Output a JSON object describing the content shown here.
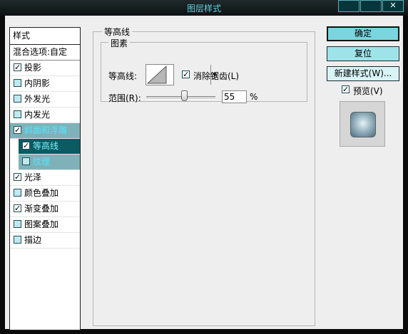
{
  "window": {
    "title": "图层样式",
    "btn_min": "",
    "btn_max": "",
    "btn_close": "✕"
  },
  "sidebar": {
    "header": "样式",
    "items": [
      {
        "label": "混合选项:自定",
        "checked": null
      },
      {
        "label": "投影",
        "checked": true
      },
      {
        "label": "内阴影",
        "checked": false
      },
      {
        "label": "外发光",
        "checked": false
      },
      {
        "label": "内发光",
        "checked": false
      },
      {
        "label": "斜面和浮雕",
        "checked": true,
        "selected": true
      },
      {
        "label": "等高线",
        "checked": true,
        "sub": true,
        "active": true
      },
      {
        "label": "纹理",
        "checked": false,
        "sub": true
      },
      {
        "label": "光泽",
        "checked": true
      },
      {
        "label": "颜色叠加",
        "checked": false
      },
      {
        "label": "渐变叠加",
        "checked": true
      },
      {
        "label": "图案叠加",
        "checked": false
      },
      {
        "label": "描边",
        "checked": false
      }
    ]
  },
  "main": {
    "group_title": "等高线",
    "subgroup_title": "图素",
    "contour_label": "等高线:",
    "antialias_label": "消除锯齿(L)",
    "antialias_checked": true,
    "range_label": "范围(R):",
    "range_value": "55",
    "range_unit": "%"
  },
  "actions": {
    "ok": "确定",
    "reset": "复位",
    "new_style": "新建样式(W)...",
    "preview_label": "预览(V)",
    "preview_checked": true
  },
  "colors": {
    "accent": "#7ad5de",
    "title_text": "#5fd3e0",
    "selected_row": "#0a5b62"
  }
}
